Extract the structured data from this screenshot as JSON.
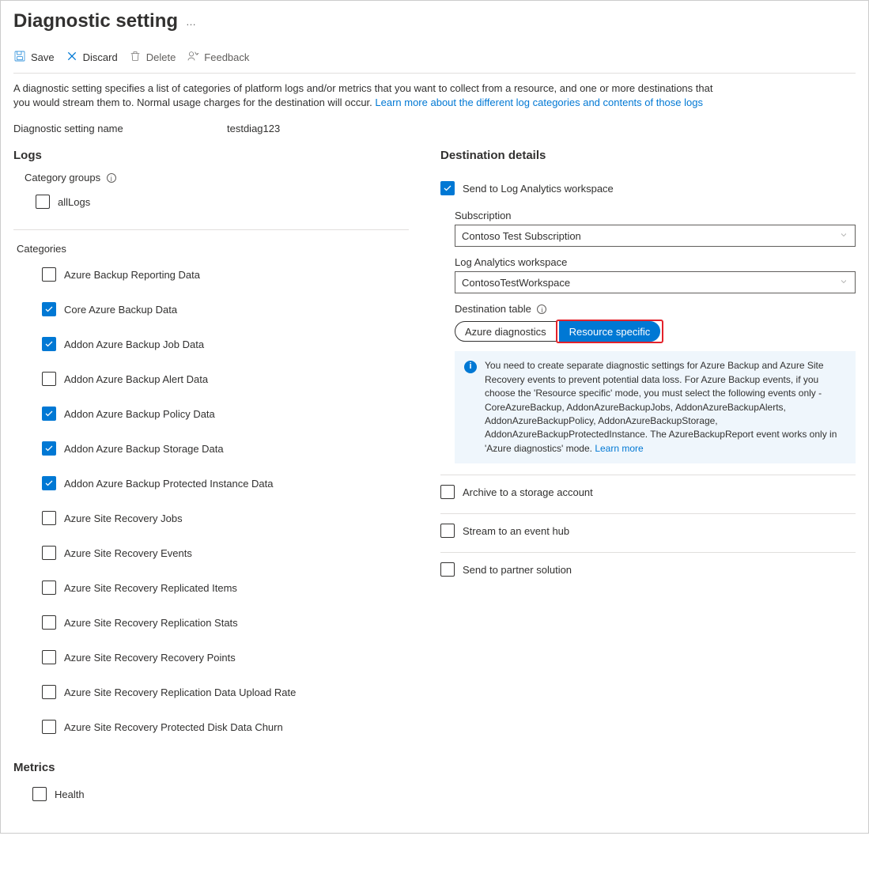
{
  "page": {
    "title": "Diagnostic setting",
    "more": "…"
  },
  "toolbar": {
    "save": "Save",
    "discard": "Discard",
    "delete": "Delete",
    "feedback": "Feedback"
  },
  "intro": {
    "text1": "A diagnostic setting specifies a list of categories of platform logs and/or metrics that you want to collect from a resource, and one or more destinations that you would stream them to. Normal usage charges for the destination will occur. ",
    "link": "Learn more about the different log categories and contents of those logs"
  },
  "name": {
    "label": "Diagnostic setting name",
    "value": "testdiag123"
  },
  "logs": {
    "heading": "Logs",
    "groups_label": "Category groups",
    "groups": [
      {
        "label": "allLogs",
        "checked": false
      }
    ],
    "categories_label": "Categories",
    "categories": [
      {
        "label": "Azure Backup Reporting Data",
        "checked": false
      },
      {
        "label": "Core Azure Backup Data",
        "checked": true
      },
      {
        "label": "Addon Azure Backup Job Data",
        "checked": true
      },
      {
        "label": "Addon Azure Backup Alert Data",
        "checked": false
      },
      {
        "label": "Addon Azure Backup Policy Data",
        "checked": true
      },
      {
        "label": "Addon Azure Backup Storage Data",
        "checked": true
      },
      {
        "label": "Addon Azure Backup Protected Instance Data",
        "checked": true
      },
      {
        "label": "Azure Site Recovery Jobs",
        "checked": false
      },
      {
        "label": "Azure Site Recovery Events",
        "checked": false
      },
      {
        "label": "Azure Site Recovery Replicated Items",
        "checked": false
      },
      {
        "label": "Azure Site Recovery Replication Stats",
        "checked": false
      },
      {
        "label": "Azure Site Recovery Recovery Points",
        "checked": false
      },
      {
        "label": "Azure Site Recovery Replication Data Upload Rate",
        "checked": false
      },
      {
        "label": "Azure Site Recovery Protected Disk Data Churn",
        "checked": false
      }
    ]
  },
  "metrics": {
    "heading": "Metrics",
    "items": [
      {
        "label": "Health",
        "checked": false
      }
    ]
  },
  "dest": {
    "heading": "Destination details",
    "la": {
      "label": "Send to Log Analytics workspace",
      "checked": true,
      "sub_label": "Subscription",
      "sub_value": "Contoso Test Subscription",
      "ws_label": "Log Analytics workspace",
      "ws_value": "ContosoTestWorkspace",
      "table_label": "Destination table",
      "opt_diag": "Azure diagnostics",
      "opt_res": "Resource specific",
      "info": "You need to create separate diagnostic settings for Azure Backup and Azure Site Recovery events to prevent potential data loss. For Azure Backup events, if you choose the 'Resource specific' mode, you must select the following events only - CoreAzureBackup, AddonAzureBackupJobs, AddonAzureBackupAlerts, AddonAzureBackupPolicy, AddonAzureBackupStorage, AddonAzureBackupProtectedInstance. The AzureBackupReport event works only in 'Azure diagnostics' mode.  ",
      "info_link": "Learn more"
    },
    "storage": {
      "label": "Archive to a storage account",
      "checked": false
    },
    "eventhub": {
      "label": "Stream to an event hub",
      "checked": false
    },
    "partner": {
      "label": "Send to partner solution",
      "checked": false
    }
  }
}
